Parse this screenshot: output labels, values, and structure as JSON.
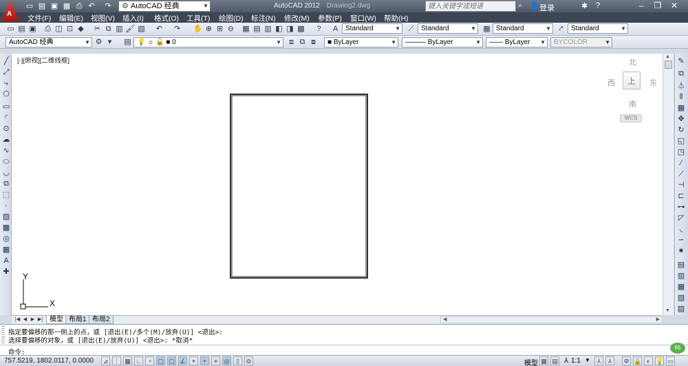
{
  "titlebar": {
    "logo_letter": "A",
    "workspace": "AutoCAD 经典",
    "app_name": "AutoCAD 2012",
    "drawing_name": "Drawing2.dwg",
    "search_placeholder": "键入关键字或短语",
    "login": "登录",
    "quick_access_icons": [
      "new-file-icon",
      "open-folder-icon",
      "save-icon",
      "save-as-icon",
      "print-icon",
      "undo-icon",
      "redo-icon"
    ],
    "window_buttons": {
      "minimize": "–",
      "restore": "❐",
      "close": "✕"
    }
  },
  "menu": {
    "items": [
      "文件(F)",
      "编辑(E)",
      "视图(V)",
      "插入(I)",
      "格式(O)",
      "工具(T)",
      "绘图(D)",
      "标注(N)",
      "修改(M)",
      "参数(P)",
      "窗口(W)",
      "帮助(H)"
    ]
  },
  "styles_toolbar": {
    "text_style": "Standard",
    "dim_style": "Standard",
    "table_style": "Standard",
    "multileader_style": "Standard"
  },
  "layers_toolbar": {
    "workspace": "AutoCAD 经典",
    "layer": "0",
    "color": "ByLayer",
    "linetype": "ByLayer",
    "lineweight": "ByLayer",
    "plotstyle": "BYCOLOR"
  },
  "viewport": {
    "label": "[-][俯视][二维线框]"
  },
  "viewcube": {
    "north": "北",
    "south": "南",
    "east": "东",
    "west": "西",
    "face": "上",
    "wcs": "WCS"
  },
  "ucs": {
    "x_label": "X",
    "y_label": "Y"
  },
  "tabs": [
    "模型",
    "布局1",
    "布局2"
  ],
  "command": {
    "history": [
      "指定要偏移的那一侧上的点，或 [退出(E)/多个(M)/放弃(U)] <退出>:",
      "选择要偏移的对象，或 [退出(E)/放弃(U)] <退出>: *取消*"
    ],
    "prompt": "命令:",
    "badge": "66"
  },
  "status": {
    "coordinates": "757.5219,  1802.0117, 0.0000",
    "model": "模型",
    "annotation_scale": "1:1",
    "colors": {
      "accent": "#5ab04a",
      "titlebar": "#4e5867"
    }
  }
}
